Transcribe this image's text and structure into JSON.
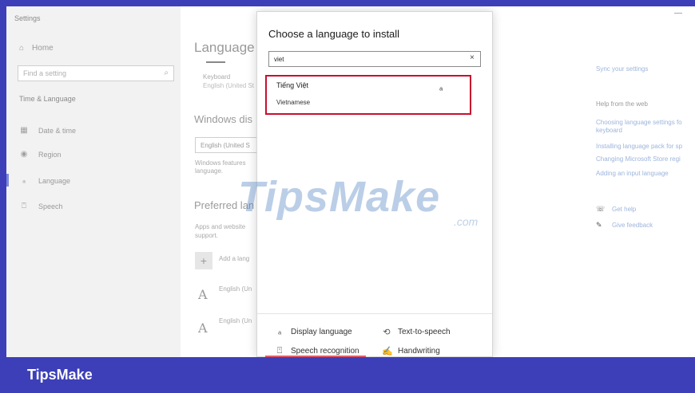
{
  "nav": {
    "title": "Settings",
    "home": "Home",
    "search_placeholder": "Find a setting",
    "section": "Time & Language",
    "items": [
      {
        "label": "Date & time",
        "icon": "calendar-icon"
      },
      {
        "label": "Region",
        "icon": "globe-icon"
      },
      {
        "label": "Language",
        "icon": "language-icon"
      },
      {
        "label": "Speech",
        "icon": "microphone-icon"
      }
    ]
  },
  "main": {
    "heading": "Language",
    "keyboard_label": "Keyboard",
    "keyboard_value": "English (United St",
    "windows_display": "Windows dis",
    "display_select": "English (United S",
    "windows_features_1": "Windows features",
    "windows_features_2": "language.",
    "preferred": "Preferred lan",
    "apps_1": "Apps and website",
    "apps_2": "support.",
    "add_language": "Add a lang",
    "lang1": "English (Un",
    "lang2": "English (Un"
  },
  "right": {
    "sync": "Sync your settings",
    "help_heading": "Help from the web",
    "links": [
      "Choosing language settings fo",
      "keyboard",
      "Installing language pack for sp",
      "Changing Microsoft Store regi",
      "Adding an input language"
    ],
    "get_help": "Get help",
    "give_feedback": "Give feedback"
  },
  "dialog": {
    "title": "Choose a language to install",
    "search_value": "viet",
    "clear": "×",
    "result_native": "Tiếng Việt",
    "result_english": "Vietnamese",
    "features": {
      "display_language": "Display language",
      "text_to_speech": "Text-to-speech",
      "speech_recognition": "Speech recognition",
      "handwriting": "Handwriting"
    }
  },
  "watermark": {
    "main": "TipsMake",
    "sub": ".com"
  },
  "footer": {
    "brand": "TipsMake"
  },
  "colors": {
    "accent": "#3d3fb8",
    "highlight_border": "#c8102e",
    "link": "#9db5dc"
  }
}
